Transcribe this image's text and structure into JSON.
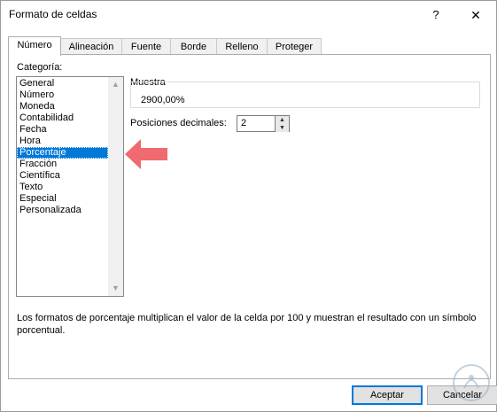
{
  "window": {
    "title": "Formato de celdas",
    "help_label": "?",
    "close_label": "✕"
  },
  "tabs": [
    {
      "label": "Número",
      "active": true
    },
    {
      "label": "Alineación",
      "active": false
    },
    {
      "label": "Fuente",
      "active": false
    },
    {
      "label": "Borde",
      "active": false
    },
    {
      "label": "Relleno",
      "active": false
    },
    {
      "label": "Proteger",
      "active": false
    }
  ],
  "category": {
    "label": "Categoría:",
    "items": [
      "General",
      "Número",
      "Moneda",
      "Contabilidad",
      "Fecha",
      "Hora",
      "Porcentaje",
      "Fracción",
      "Científica",
      "Texto",
      "Especial",
      "Personalizada"
    ],
    "selected": "Porcentaje"
  },
  "sample": {
    "label": "Muestra",
    "value": "2900,00%"
  },
  "decimals": {
    "label": "Posiciones decimales:",
    "value": "2"
  },
  "description": "Los formatos de porcentaje multiplican el valor de la celda por 100 y muestran el resultado con un símbolo porcentual.",
  "buttons": {
    "ok": "Aceptar",
    "cancel": "Cancelar"
  },
  "colors": {
    "selection": "#0078d7",
    "annotation_arrow": "#f06a6f"
  }
}
